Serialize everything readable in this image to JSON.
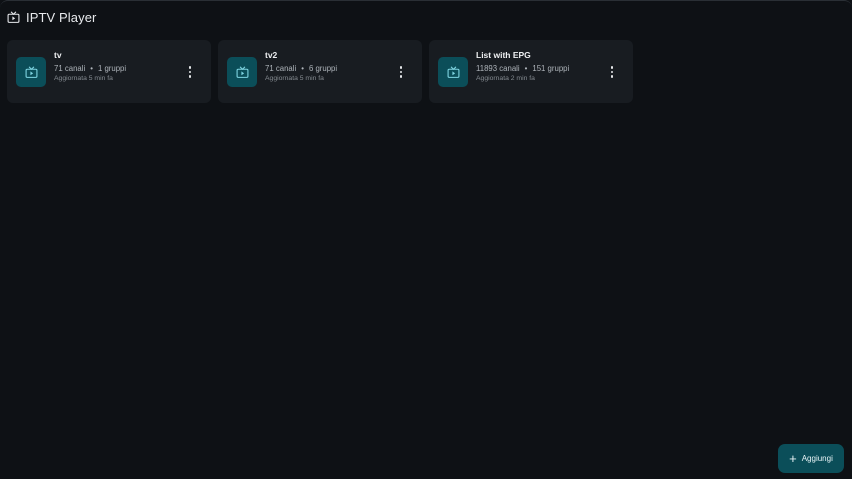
{
  "app": {
    "title": "IPTV Player",
    "icon": "live-tv-icon"
  },
  "playlists": [
    {
      "name": "tv",
      "channels": "71 canali",
      "groups": "1 gruppi",
      "separator": "•",
      "updated": "Aggiornata 5 min fa",
      "icon": "live-tv-icon"
    },
    {
      "name": "tv2",
      "channels": "71 canali",
      "groups": "6 gruppi",
      "separator": "•",
      "updated": "Aggiornata 5 min fa",
      "icon": "live-tv-icon"
    },
    {
      "name": "List with EPG",
      "channels": "11893 canali",
      "groups": "151 gruppi",
      "separator": "•",
      "updated": "Aggiornata 2 min fa",
      "icon": "live-tv-icon"
    }
  ],
  "fab": {
    "label": "Aggiungi",
    "icon": "plus-icon",
    "symbol": "+"
  },
  "colors": {
    "background": "#0e1115",
    "card": "#181c21",
    "accent": "#0b4e59",
    "accent_icon": "#7fd6e3"
  }
}
